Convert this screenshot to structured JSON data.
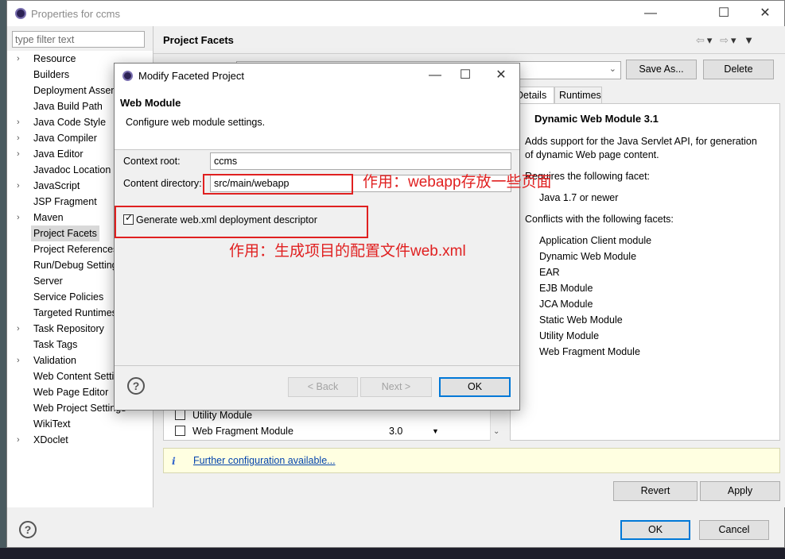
{
  "window": {
    "title": "Properties for ccms"
  },
  "filter": {
    "placeholder": "type filter text"
  },
  "tree": {
    "items": [
      {
        "label": "Resource",
        "arrow": true
      },
      {
        "label": "Builders",
        "arrow": false
      },
      {
        "label": "Deployment Assembly",
        "arrow": false
      },
      {
        "label": "Java Build Path",
        "arrow": false
      },
      {
        "label": "Java Code Style",
        "arrow": true
      },
      {
        "label": "Java Compiler",
        "arrow": true
      },
      {
        "label": "Java Editor",
        "arrow": true
      },
      {
        "label": "Javadoc Location",
        "arrow": false
      },
      {
        "label": "JavaScript",
        "arrow": true
      },
      {
        "label": "JSP Fragment",
        "arrow": false
      },
      {
        "label": "Maven",
        "arrow": true
      },
      {
        "label": "Project Facets",
        "arrow": false,
        "selected": true
      },
      {
        "label": "Project References",
        "arrow": false
      },
      {
        "label": "Run/Debug Settings",
        "arrow": false
      },
      {
        "label": "Server",
        "arrow": false
      },
      {
        "label": "Service Policies",
        "arrow": false
      },
      {
        "label": "Targeted Runtimes",
        "arrow": false
      },
      {
        "label": "Task Repository",
        "arrow": true
      },
      {
        "label": "Task Tags",
        "arrow": false
      },
      {
        "label": "Validation",
        "arrow": true
      },
      {
        "label": "Web Content Settings",
        "arrow": false
      },
      {
        "label": "Web Page Editor",
        "arrow": false
      },
      {
        "label": "Web Project Settings",
        "arrow": false
      },
      {
        "label": "WikiText",
        "arrow": false
      },
      {
        "label": "XDoclet",
        "arrow": true
      }
    ]
  },
  "facets": {
    "title": "Project Facets",
    "save_as": "Save As...",
    "delete": "Delete",
    "rows": [
      {
        "name": "Utility Module",
        "version": ""
      },
      {
        "name": "Web Fragment Module",
        "version": "3.0"
      }
    ],
    "tabs": {
      "details": "Details",
      "runtimes": "Runtimes"
    },
    "details": {
      "heading": "Dynamic Web Module 3.1",
      "desc1": "Adds support for the Java Servlet API, for generation",
      "desc2": "of dynamic Web page content.",
      "requires": "Requires the following facet:",
      "requires_items": [
        "Java 1.7 or newer"
      ],
      "conflicts": "Conflicts with the following facets:",
      "conflict_items": [
        "Application Client module",
        "Dynamic Web Module",
        "EAR",
        "EJB Module",
        "JCA Module",
        "Static Web Module",
        "Utility Module",
        "Web Fragment Module"
      ]
    },
    "info_link": "Further configuration available...",
    "revert": "Revert",
    "apply": "Apply"
  },
  "footer": {
    "ok": "OK",
    "cancel": "Cancel"
  },
  "dialog": {
    "title": "Modify Faceted Project",
    "heading": "Web Module",
    "description": "Configure web module settings.",
    "context_root_label": "Context root:",
    "context_root_value": "ccms",
    "content_dir_label": "Content directory:",
    "content_dir_value": "src/main/webapp",
    "generate_label": "Generate web.xml deployment descriptor",
    "back": "< Back",
    "next": "Next >",
    "ok": "OK"
  },
  "annotations": {
    "webapp": "作用：webapp存放一些页面",
    "webxml": "作用：生成项目的配置文件web.xml"
  },
  "colors": {
    "accent": "#0078d7",
    "annotation": "#e02020"
  }
}
